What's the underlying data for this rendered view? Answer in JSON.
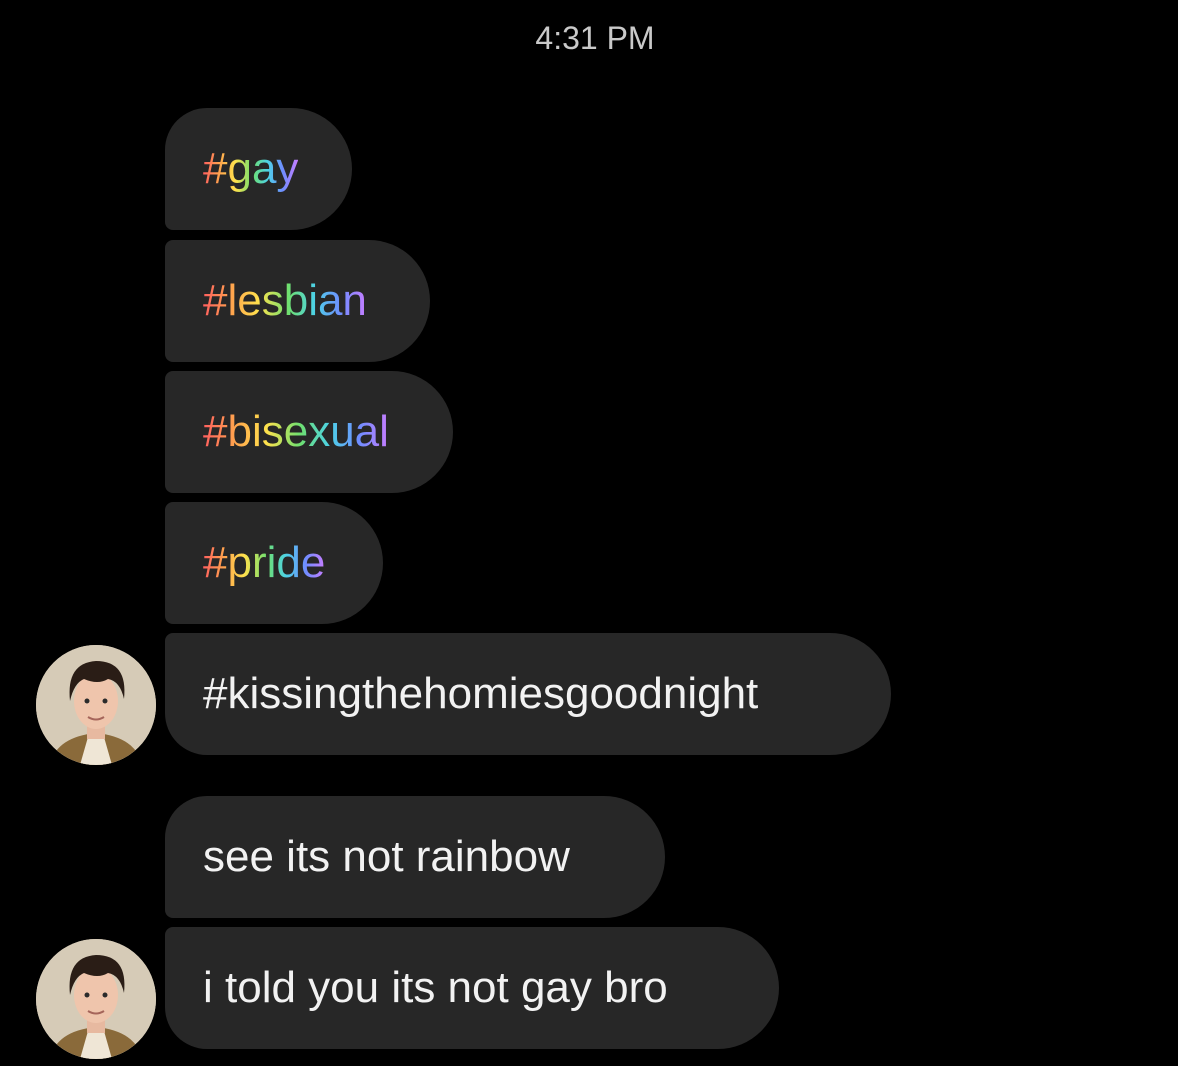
{
  "header": {
    "time": "4:31 PM"
  },
  "messages": [
    {
      "text": "#gay",
      "style": "rainbow"
    },
    {
      "text": "#lesbian",
      "style": "rainbow"
    },
    {
      "text": "#bisexual",
      "style": "rainbow"
    },
    {
      "text": "#pride",
      "style": "rainbow"
    },
    {
      "text": "#kissingthehomiesgoodnight",
      "style": "plain"
    },
    {
      "text": "see its not rainbow",
      "style": "plain"
    },
    {
      "text": "i told you its not gay bro",
      "style": "plain"
    }
  ],
  "colors": {
    "background": "#000000",
    "bubble": "#272727",
    "text": "#f2f2f2",
    "timestamp": "#c9c9c9"
  },
  "icons": [
    "sender-avatar"
  ]
}
